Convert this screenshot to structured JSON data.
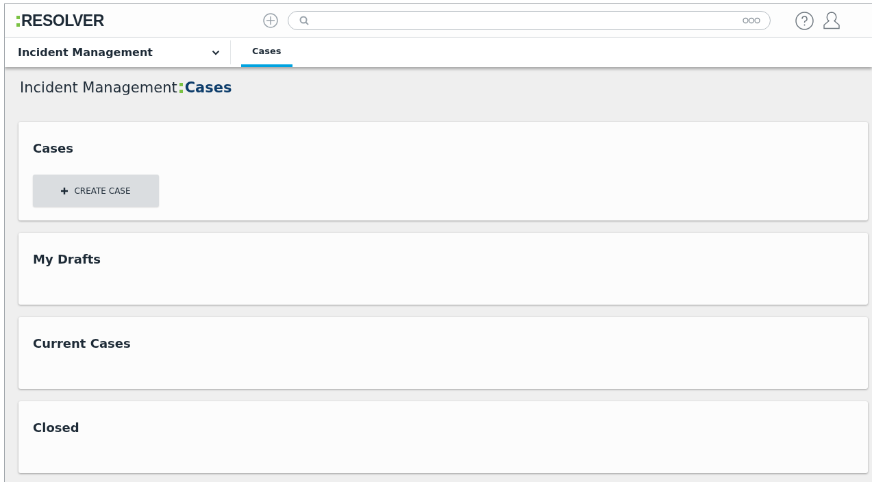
{
  "header": {
    "logo": "RESOLVER"
  },
  "nav": {
    "app_menu": "Incident Management",
    "tabs": [
      {
        "label": "Cases",
        "selected": true
      }
    ]
  },
  "page_title": {
    "app": "Incident Management",
    "section": "Cases"
  },
  "cards": [
    {
      "title": "Cases",
      "button": "CREATE CASE"
    },
    {
      "title": "My Drafts"
    },
    {
      "title": "Current Cases"
    },
    {
      "title": "Closed"
    }
  ]
}
